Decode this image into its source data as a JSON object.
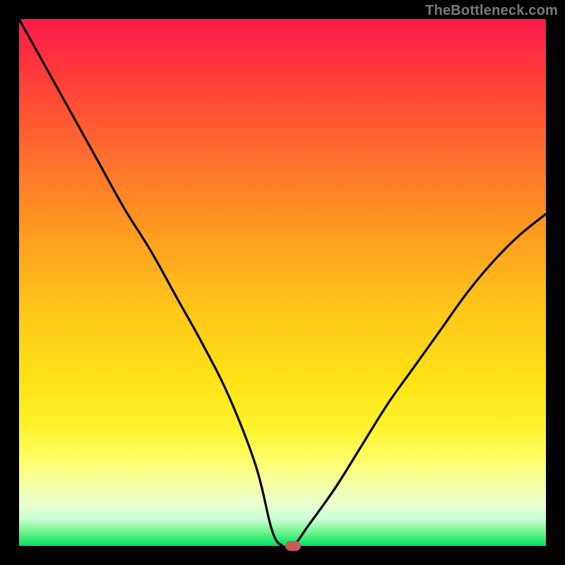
{
  "watermark": "TheBottleneck.com",
  "colors": {
    "curve": "#000000",
    "marker": "#c75a5a",
    "frame": "#000000"
  },
  "chart_data": {
    "type": "line",
    "title": "",
    "xlabel": "",
    "ylabel": "",
    "xlim": [
      0,
      100
    ],
    "ylim": [
      0,
      100
    ],
    "grid": false,
    "legend": false,
    "annotations": [
      {
        "name": "minimum-marker",
        "x": 52,
        "y": 0,
        "shape": "pill",
        "color": "#c75a5a"
      }
    ],
    "series": [
      {
        "name": "bottleneck-curve",
        "x": [
          0,
          5,
          10,
          15,
          20,
          25,
          30,
          35,
          40,
          45,
          48,
          50,
          52,
          55,
          60,
          65,
          70,
          75,
          80,
          85,
          90,
          95,
          100
        ],
        "y": [
          100,
          91,
          82,
          73,
          64,
          56,
          47,
          38,
          28,
          15,
          3,
          0,
          0,
          4,
          11,
          19,
          27,
          34,
          41,
          48,
          54,
          59,
          63
        ]
      }
    ]
  }
}
